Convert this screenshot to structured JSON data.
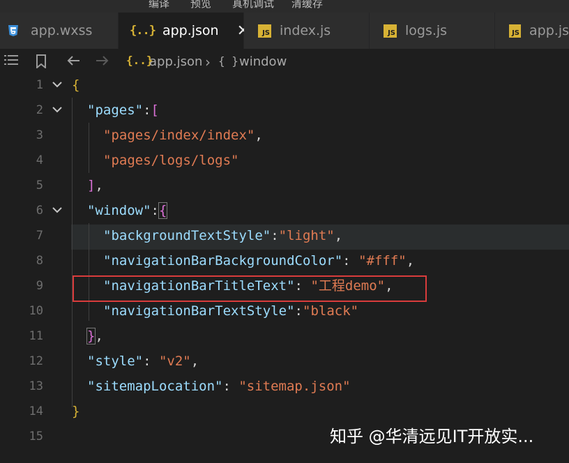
{
  "menu": [
    "编译",
    "预览",
    "真机调试",
    "清缓存"
  ],
  "tabs": [
    {
      "label": "app.wxss",
      "icon": "css-file-icon",
      "active": false
    },
    {
      "label": "app.json",
      "icon": "json-file-icon",
      "active": true
    },
    {
      "label": "index.js",
      "icon": "js-file-icon",
      "active": false
    },
    {
      "label": "logs.js",
      "icon": "js-file-icon",
      "active": false
    },
    {
      "label": "app.js",
      "icon": "js-file-icon",
      "active": false
    }
  ],
  "js_badge": "JS",
  "json_badge": "{..}",
  "close_glyph": "✕",
  "breadcrumb": {
    "file": "app.json",
    "symbol_icon": "{ }",
    "symbol": "window"
  },
  "line_numbers": [
    "1",
    "2",
    "3",
    "4",
    "5",
    "6",
    "7",
    "8",
    "9",
    "10",
    "11",
    "12",
    "13",
    "14",
    "15"
  ],
  "code": {
    "l1": "{",
    "l2_key": "\"pages\"",
    "l2_colon": ":",
    "l2_bracket": "[",
    "l3_val": "\"pages/index/index\"",
    "l3_comma": ",",
    "l4_val": "\"pages/logs/logs\"",
    "l5_bracket": "]",
    "l5_comma": ",",
    "l6_key": "\"window\"",
    "l6_colon": ":",
    "l6_brace": "{",
    "l7_key": "\"backgroundTextStyle\"",
    "l7_colon": ":",
    "l7_val": "\"light\"",
    "l7_comma": ",",
    "l8_key": "\"navigationBarBackgroundColor\"",
    "l8_colon": ": ",
    "l8_val": "\"#fff\"",
    "l8_comma": ",",
    "l9_key": "\"navigationBarTitleText\"",
    "l9_colon": ": ",
    "l9_val": "\"工程demo\"",
    "l9_comma": ",",
    "l10_key": "\"navigationBarTextStyle\"",
    "l10_colon": ":",
    "l10_val": "\"black\"",
    "l11_brace": "}",
    "l11_comma": ",",
    "l12_key": "\"style\"",
    "l12_colon": ": ",
    "l12_val": "\"v2\"",
    "l12_comma": ",",
    "l13_key": "\"sitemapLocation\"",
    "l13_colon": ": ",
    "l13_val": "\"sitemap.json\"",
    "l14": "}"
  },
  "watermark": "知乎 @华清远见IT开放实...",
  "colors": {
    "background": "#1e1e1e",
    "key": "#9cdcfe",
    "string": "#e07b53",
    "bracket_gold": "#d7b235",
    "bracket_purple": "#da70d6",
    "bracket_blue": "#2f9bff",
    "highlight_box": "#d93c3c"
  }
}
